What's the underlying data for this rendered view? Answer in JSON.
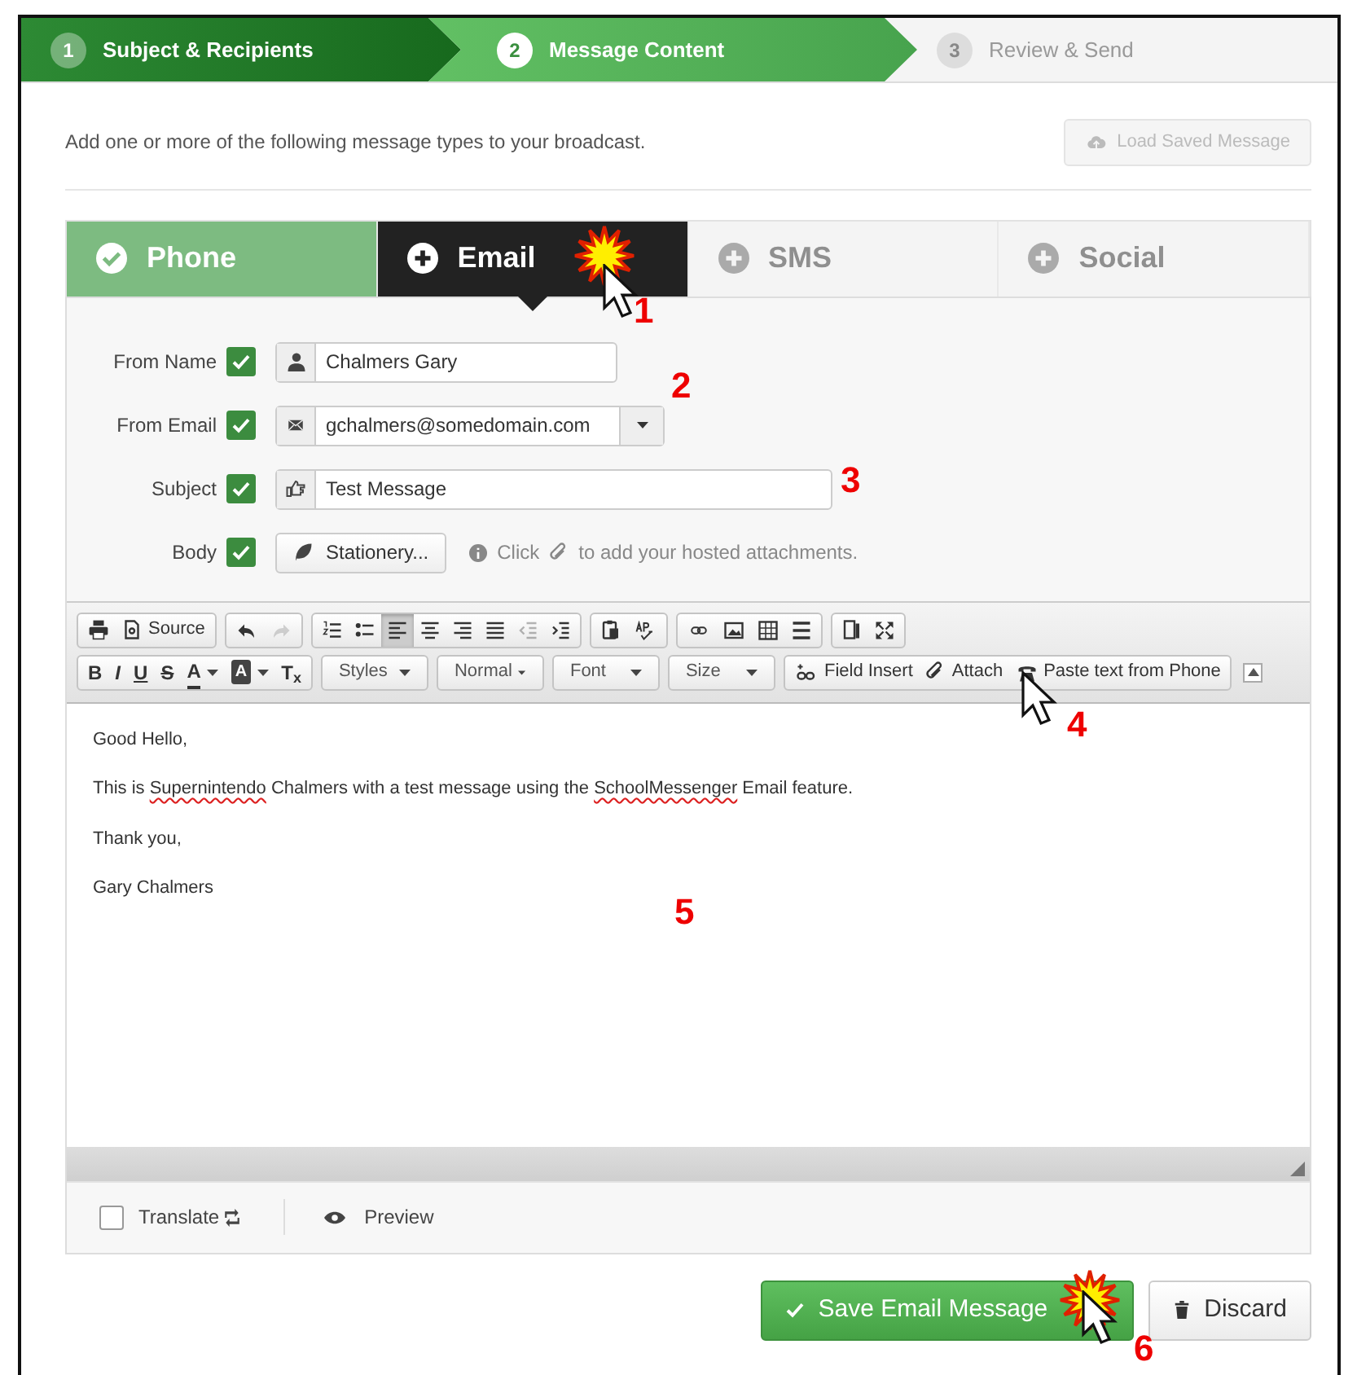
{
  "steps": [
    {
      "number": "1",
      "label": "Subject & Recipients",
      "completed": true,
      "selected": false
    },
    {
      "number": "2",
      "label": "Message Content",
      "completed": false,
      "selected": true
    },
    {
      "number": "3",
      "label": "Review & Send",
      "completed": false,
      "selected": false
    }
  ],
  "intro": "Add one or more of the following message types to your broadcast.",
  "load_button": {
    "label": "Load Saved Message",
    "disabled": true
  },
  "tabs": [
    {
      "label": "Phone",
      "selected": false,
      "completed": true
    },
    {
      "label": "Email",
      "selected": true,
      "completed": false
    },
    {
      "label": "SMS",
      "selected": false,
      "completed": false
    },
    {
      "label": "Social",
      "selected": false,
      "completed": false
    }
  ],
  "fields": [
    {
      "label": "From Name",
      "checked": true,
      "value": "Chalmers Gary",
      "kind": "text"
    },
    {
      "label": "From Email",
      "checked": true,
      "value": "gchalmers@somedomain.com",
      "kind": "select"
    },
    {
      "label": "Subject",
      "checked": true,
      "value": "Test Message",
      "kind": "wide"
    }
  ],
  "body": {
    "label": "Body",
    "checked": true,
    "stationery": "Stationery...",
    "note_before": "Click",
    "note_after": "to add your hosted attachments."
  },
  "toolbar": [
    [
      [
        {
          "kind": "icon"
        },
        {
          "kind": "icon-text",
          "label": "Source"
        }
      ],
      [
        {
          "kind": "icon",
          "disabled": false
        },
        {
          "kind": "icon",
          "disabled": true
        }
      ],
      [
        {
          "kind": "icon",
          "selected": false,
          "disabled": false
        },
        {
          "kind": "icon",
          "selected": false,
          "disabled": false
        },
        {
          "kind": "icon",
          "selected": true,
          "disabled": false
        },
        {
          "kind": "icon",
          "selected": false,
          "disabled": false
        },
        {
          "kind": "icon",
          "selected": false,
          "disabled": false
        },
        {
          "kind": "icon",
          "selected": false,
          "disabled": false
        },
        {
          "kind": "icon",
          "selected": false,
          "disabled": true
        },
        {
          "kind": "icon",
          "selected": false,
          "disabled": false
        }
      ],
      [
        {
          "kind": "icon"
        },
        {
          "kind": "icon"
        }
      ],
      [
        {
          "kind": "icon"
        },
        {
          "kind": "icon"
        },
        {
          "kind": "icon"
        },
        {
          "kind": "icon"
        }
      ],
      [
        {
          "kind": "icon"
        },
        {
          "kind": "icon"
        }
      ]
    ],
    [
      [
        {
          "kind": "glyph",
          "label": "B"
        },
        {
          "kind": "glyph",
          "label": "I"
        },
        {
          "kind": "glyph",
          "label": "U"
        },
        {
          "kind": "glyph",
          "label": "S"
        },
        {
          "kind": "color",
          "label": "A"
        },
        {
          "kind": "bgcolor",
          "label": "A"
        },
        {
          "kind": "glyph",
          "label": "T$_{x}$"
        }
      ],
      [
        {
          "kind": "combo",
          "label": "Styles"
        }
      ],
      [
        {
          "kind": "combo",
          "label": "Normal"
        }
      ],
      [
        {
          "kind": "combo",
          "label": "Font"
        }
      ],
      [
        {
          "kind": "combo",
          "label": "Size"
        }
      ],
      [
        {
          "kind": "icon-text",
          "label": "Field Insert"
        },
        {
          "kind": "icon-text",
          "label": "Attach"
        },
        {
          "kind": "icon-text",
          "label": "Paste text from Phone"
        }
      ],
      [
        {
          "kind": "collapse"
        }
      ]
    ]
  ],
  "content": [
    [
      {
        "text": "Good Hello,"
      }
    ],
    [
      {
        "text": "This is "
      },
      {
        "text": "Supernintendo",
        "misspelled": true
      },
      {
        "text": " Chalmers with a test message using the "
      },
      {
        "text": "SchoolMessenger",
        "misspelled": true
      },
      {
        "text": " Email feature."
      }
    ],
    [
      {
        "text": "Thank you,"
      }
    ],
    [
      {
        "text": "Gary Chalmers"
      }
    ]
  ],
  "translate": {
    "label": "Translate",
    "checked": false
  },
  "preview": "Preview",
  "save_button": "Save Email Message",
  "discard_button": "Discard",
  "annotations": [
    {
      "number": "1",
      "cursor": true,
      "burst": true
    },
    {
      "number": "2",
      "cursor": false,
      "burst": false
    },
    {
      "number": "3",
      "cursor": false,
      "burst": false
    },
    {
      "number": "4",
      "cursor": true,
      "burst": false
    },
    {
      "number": "5",
      "cursor": false,
      "burst": false
    },
    {
      "number": "6",
      "cursor": true,
      "burst": true
    }
  ]
}
